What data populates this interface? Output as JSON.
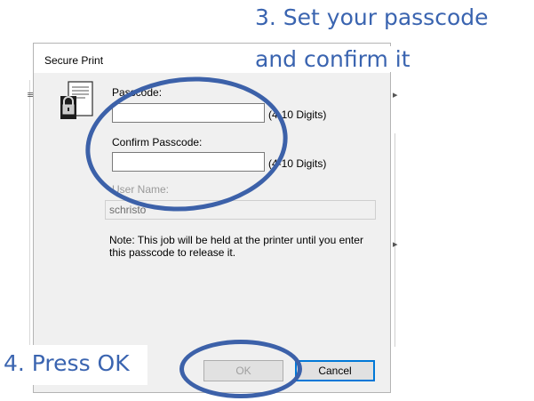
{
  "dialog": {
    "title": "Secure Print",
    "passcode_label": "Passcode:",
    "passcode_value": "",
    "passcode_hint": "(4-10 Digits)",
    "confirm_label": "Confirm Passcode:",
    "confirm_value": "",
    "confirm_hint": "(4-10 Digits)",
    "username_label": "User Name:",
    "username_value": "schristo",
    "note": "Note:  This job will be held at the printer until you enter this passcode to release it.",
    "ok_label": "OK",
    "cancel_label": "Cancel",
    "ok_enabled": false
  },
  "annotations": {
    "step3_line1": "3. Set your passcode",
    "step3_line2": "and confirm it",
    "step4": "4. Press OK",
    "color": "#3a64b0",
    "ring_color": "#3c61a9"
  },
  "icons": [
    "secure-print-lock-icon",
    "close-icon"
  ],
  "colors": {
    "dialog_bg": "#f0f0f0",
    "cancel_focus_border": "#0078d7"
  }
}
